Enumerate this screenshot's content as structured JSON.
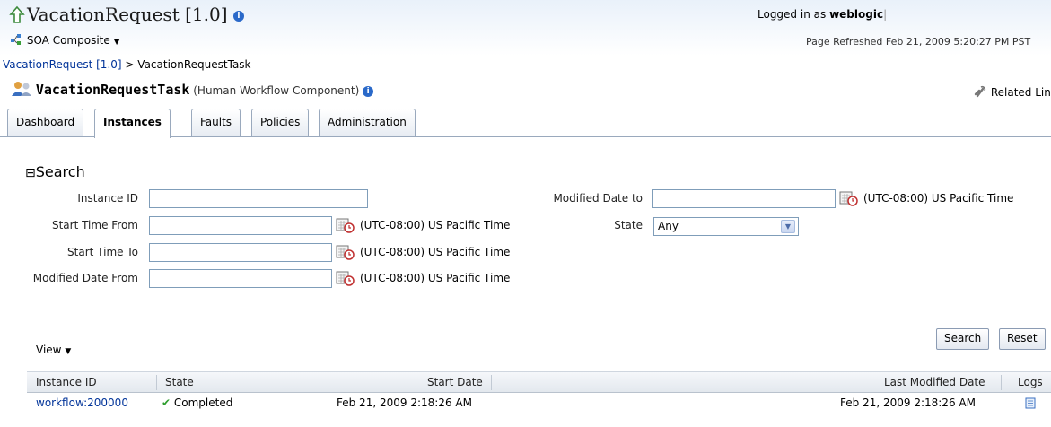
{
  "header": {
    "app_title": "VacationRequest [1.0]",
    "composite_menu": "SOA Composite",
    "logged_in_prefix": "Logged in as",
    "logged_in_user": "weblogic",
    "refreshed": "Page Refreshed Feb 21, 2009 5:20:27 PM PST"
  },
  "breadcrumb": {
    "root": "VacationRequest [1.0]",
    "separator": ">",
    "current": "VacationRequestTask"
  },
  "component": {
    "name": "VacationRequestTask",
    "type": "(Human Workflow Component)",
    "related_link": "Related Link"
  },
  "tabs": [
    {
      "label": "Dashboard",
      "active": false
    },
    {
      "label": "Instances",
      "active": true
    },
    {
      "label": "Faults",
      "active": false
    },
    {
      "label": "Policies",
      "active": false
    },
    {
      "label": "Administration",
      "active": false
    }
  ],
  "search": {
    "title": "Search",
    "collapse_glyph": "⊟",
    "fields": {
      "instance_id": {
        "label": "Instance ID",
        "value": ""
      },
      "start_time_from": {
        "label": "Start Time From",
        "value": ""
      },
      "start_time_to": {
        "label": "Start Time To",
        "value": ""
      },
      "modified_date_from": {
        "label": "Modified Date From",
        "value": ""
      },
      "modified_date_to": {
        "label": "Modified Date to",
        "value": ""
      },
      "state": {
        "label": "State",
        "value": "Any"
      }
    },
    "timezone": "(UTC-08:00) US Pacific Time",
    "search_button": "Search",
    "reset_button": "Reset"
  },
  "results": {
    "view_menu": "View",
    "columns": [
      "Instance ID",
      "State",
      "Start Date",
      "Last Modified Date",
      "Logs"
    ],
    "rows": [
      {
        "instance_id": "workflow:200000",
        "state": "Completed",
        "start_date": "Feb 21, 2009 2:18:26 AM",
        "last_modified": "Feb 21, 2009 2:18:26 AM"
      }
    ]
  },
  "colors": {
    "link": "#003399",
    "header_band": "#e9f1fa",
    "tab_border": "#9aa9bd",
    "check": "#2e9e2e",
    "info_icon": "#2a69c9"
  },
  "icons": [
    "up-arrow-icon",
    "info-icon",
    "composite-icon",
    "component-icon",
    "related-link-icon",
    "calendar-icon",
    "dropdown-arrow-icon",
    "check-icon",
    "log-icon"
  ]
}
